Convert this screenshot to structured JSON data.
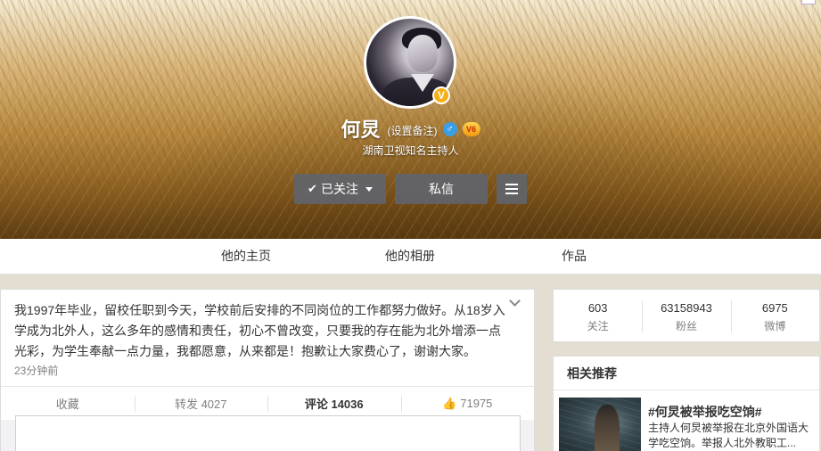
{
  "profile": {
    "name": "何炅",
    "remark_label": "(设置备注)",
    "intro": "湖南卫视知名主持人",
    "verified_badge": "V",
    "gender_symbol": "♂",
    "vip_badge": "V6"
  },
  "buttons": {
    "follow_label": "已关注",
    "message_label": "私信"
  },
  "nav": {
    "tabs": [
      {
        "label": "他的主页"
      },
      {
        "label": "他的相册"
      },
      {
        "label": "作品"
      }
    ]
  },
  "post": {
    "text": "我1997年毕业，留校任职到今天，学校前后安排的不同岗位的工作都努力做好。从18岁入学成为北外人，这么多年的感情和责任，初心不曾改变，只要我的存在能为北外增添一点光彩，为学生奉献一点力量，我都愿意，从来都是！抱歉让大家费心了，谢谢大家。",
    "time": "23分钟前",
    "actions": {
      "collect": "收藏",
      "repost": "转发 4027",
      "comment": "评论 14036",
      "like": "71975"
    }
  },
  "stats": [
    {
      "value": "603",
      "label": "关注"
    },
    {
      "value": "63158943",
      "label": "粉丝"
    },
    {
      "value": "6975",
      "label": "微博"
    }
  ],
  "related": {
    "title": "相关推荐",
    "item": {
      "headline": "#何炅被举报吃空饷#",
      "desc_line1": "主持人何炅被举报在北京外国语大",
      "desc_line2": "学吃空饷。举报人北外教职工..."
    }
  },
  "colors": {
    "vip_gold": "#f6b016",
    "gender_blue": "#3a9ee4",
    "button_gray": "#60646e"
  }
}
